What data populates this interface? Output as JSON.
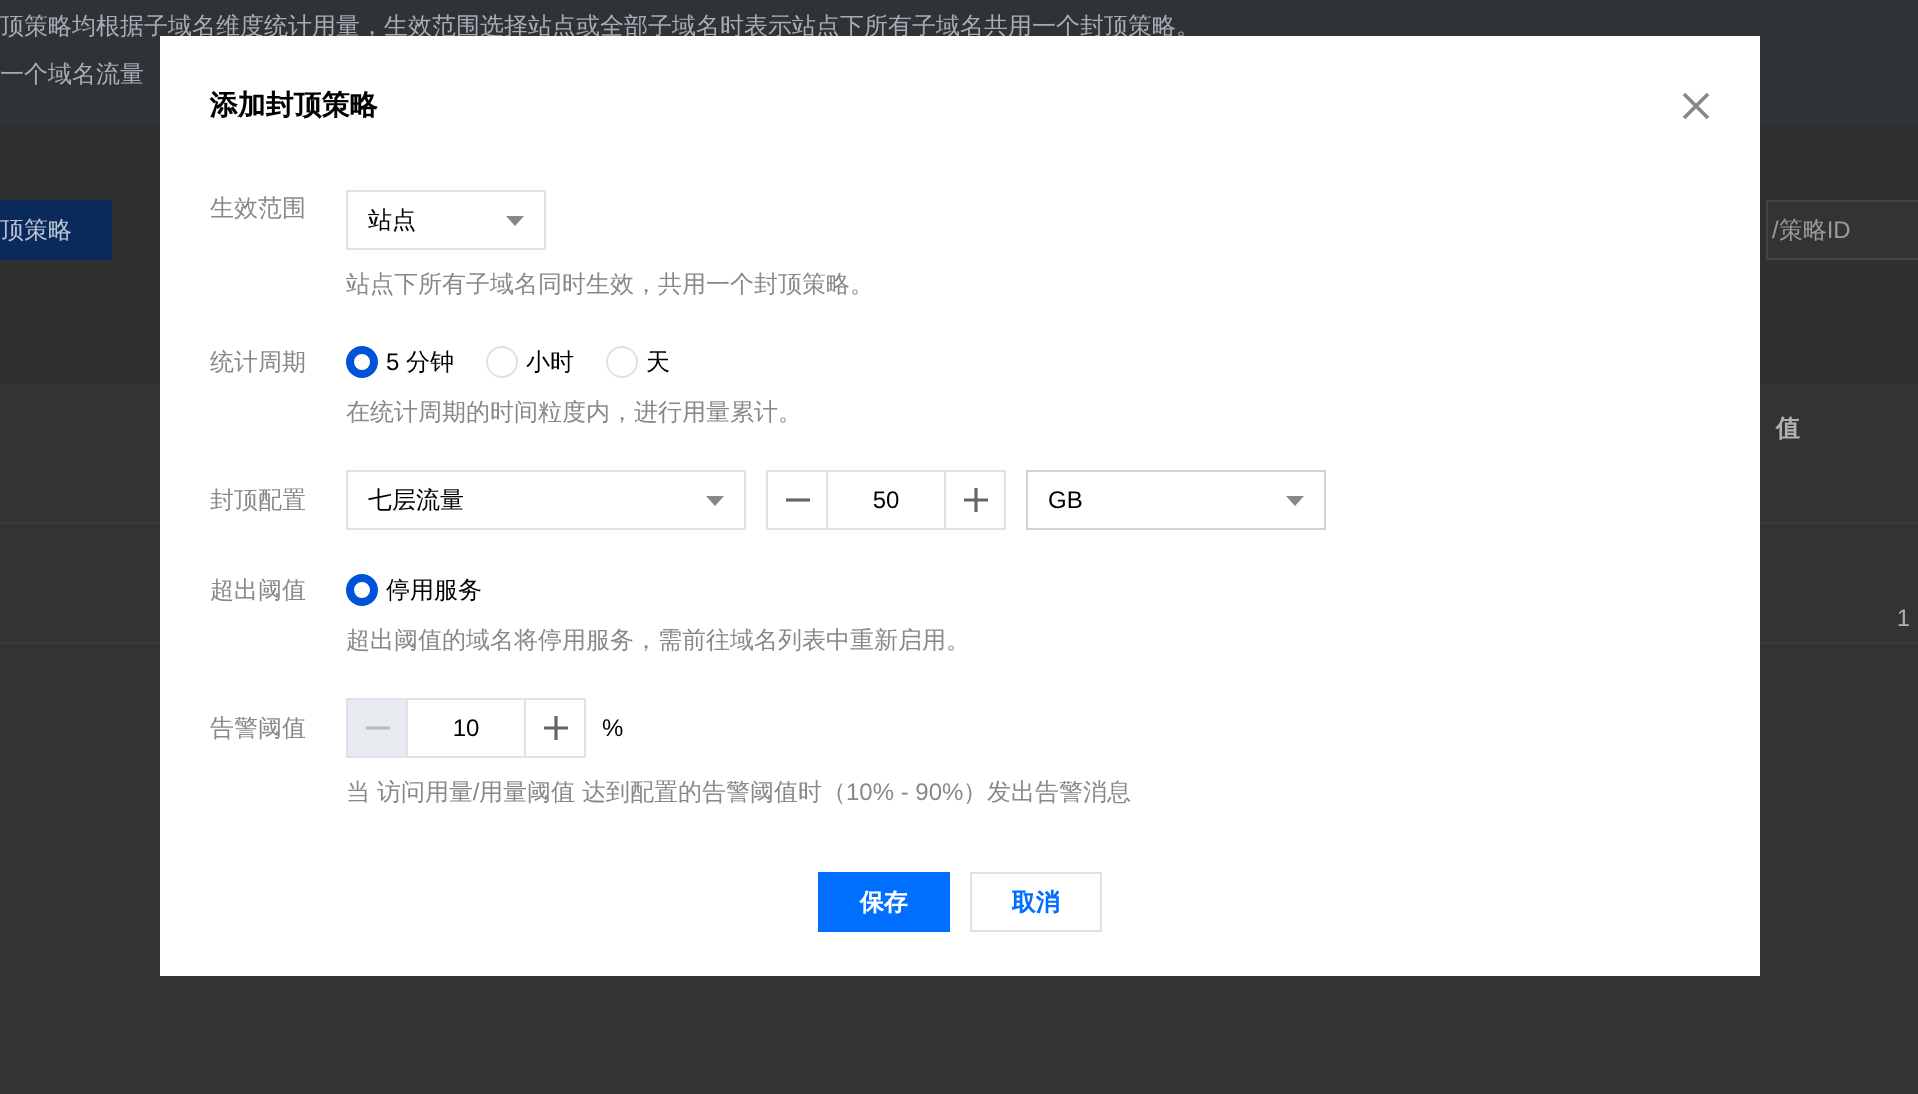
{
  "background": {
    "notice_lines": [
      "顶策略均根据子域名维度统计用量，生效范围选择站点或全部子域名时表示站点下所有子域名共用一个封顶策略。",
      "一个域名流量"
    ],
    "create_button": "顶策略",
    "search": {
      "placeholder": "/策略ID"
    },
    "table": {
      "column_header": "值",
      "cell": "1"
    }
  },
  "dialog": {
    "title": "添加封顶策略",
    "fields": [
      {
        "kind": "select",
        "label": "生效范围",
        "value": "站点",
        "hint": "站点下所有子域名同时生效，共用一个封顶策略。"
      },
      {
        "kind": "radio",
        "label": "统计周期",
        "options": [
          {
            "label": "5 分钟",
            "selected": true
          },
          {
            "label": "小时",
            "selected": false
          },
          {
            "label": "天",
            "selected": false
          }
        ],
        "hint": "在统计周期的时间粒度内，进行用量累计。"
      },
      {
        "kind": "cap",
        "label": "封顶配置",
        "metric": "七层流量",
        "amount": "50",
        "unit": "GB"
      },
      {
        "kind": "radio",
        "label": "超出阈值",
        "options": [
          {
            "label": "停用服务",
            "selected": true
          }
        ],
        "hint": "超出阈值的域名将停用服务，需前往域名列表中重新启用。"
      },
      {
        "kind": "stepper",
        "label": "告警阈值",
        "value": "10",
        "minus_disabled": true,
        "suffix": "%",
        "hint": "当 访问用量/用量阈值 达到配置的告警阈值时（10% - 90%）发出告警消息"
      }
    ],
    "buttons": [
      {
        "label": "保存",
        "primary": true
      },
      {
        "label": "取消",
        "primary": false
      }
    ]
  }
}
